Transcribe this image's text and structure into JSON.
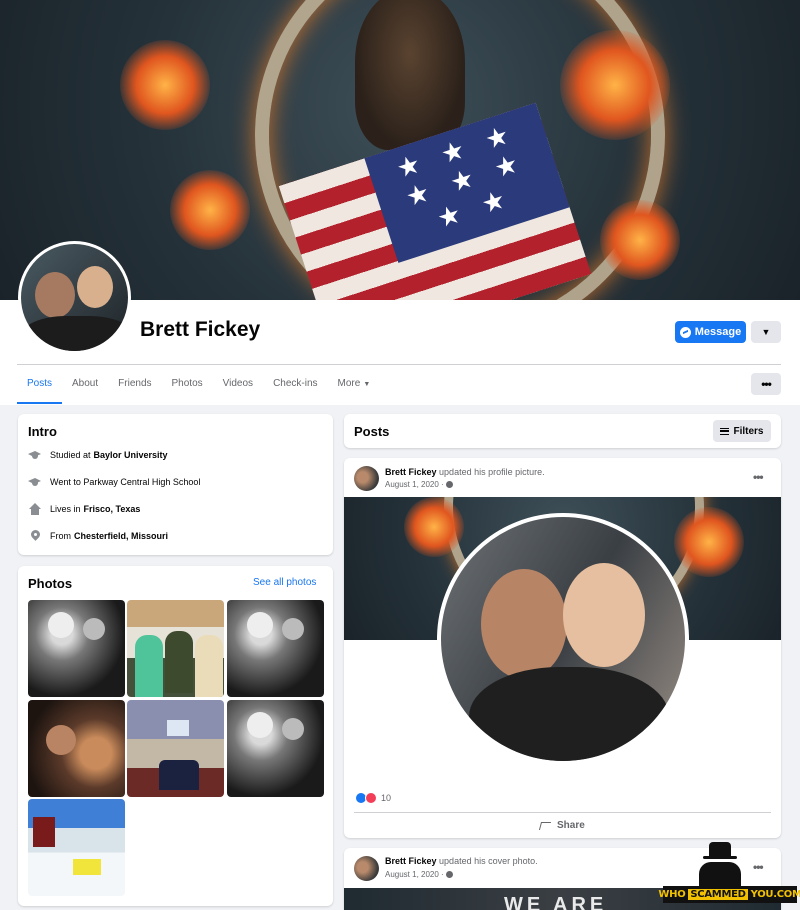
{
  "profile": {
    "name": "Brett Fickey"
  },
  "actions": {
    "message_label": "Message",
    "caret": "▼",
    "more_dots": "•••"
  },
  "tabs": [
    {
      "label": "Posts",
      "active": true
    },
    {
      "label": "About"
    },
    {
      "label": "Friends"
    },
    {
      "label": "Photos"
    },
    {
      "label": "Videos"
    },
    {
      "label": "Check-ins"
    },
    {
      "label": "More"
    }
  ],
  "intro": {
    "title": "Intro",
    "items": [
      {
        "icon": "graduation-cap-icon",
        "prefix": "Studied at",
        "value": "Baylor University"
      },
      {
        "icon": "graduation-cap-icon",
        "prefix": "Went to Parkway Central High School",
        "value": ""
      },
      {
        "icon": "home-icon",
        "prefix": "Lives in",
        "value": "Frisco, Texas"
      },
      {
        "icon": "location-pin-icon",
        "prefix": "From",
        "value": "Chesterfield, Missouri"
      }
    ]
  },
  "photos": {
    "title": "Photos",
    "see_all": "See all photos"
  },
  "posts_header": {
    "title": "Posts",
    "filters_label": "Filters"
  },
  "posts": [
    {
      "author": "Brett Fickey",
      "action": "updated his profile picture.",
      "date": "August 1, 2020 ·",
      "reaction_count": "10",
      "share_label": "Share"
    },
    {
      "author": "Brett Fickey",
      "action": "updated his cover photo.",
      "date": "August 1, 2020 ·",
      "cover_text": "WE ARE"
    }
  ],
  "watermark": {
    "left": "WHO",
    "middle": "SCAMMED",
    "right": "YOU.COM"
  },
  "colors": {
    "accent": "#1877f2",
    "background": "#f0f2f5",
    "love": "#f33e58"
  }
}
